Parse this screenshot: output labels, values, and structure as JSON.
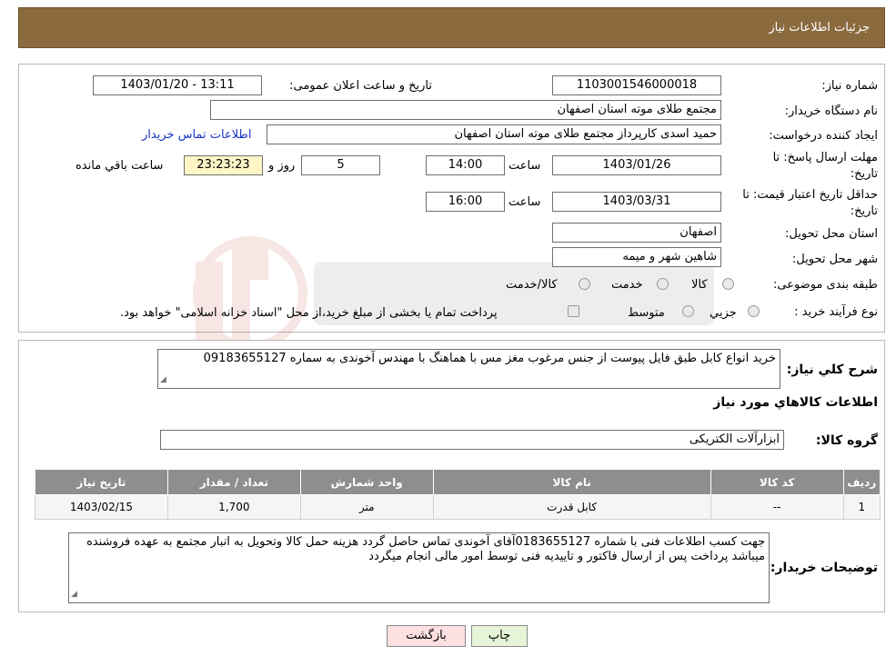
{
  "header": {
    "title": "جزئیات اطلاعات نیاز"
  },
  "form": {
    "need_number_label": "شماره نیاز:",
    "need_number": "1103001546000018",
    "announce_label": "تاریخ و ساعت اعلان عمومی:",
    "announce_value": "1403/01/20 - 13:11",
    "buyer_org_label": "نام دستگاه خریدار:",
    "buyer_org": "مجتمع طلای موته استان اصفهان",
    "creator_label": "ایجاد کننده درخواست:",
    "creator": "حمید اسدی کارپرداز مجتمع طلای موته استان اصفهان",
    "contact_link": "اطلاعات تماس خریدار",
    "deadline_label_1": "مهلت ارسال پاسخ: تا",
    "deadline_label_2": "تاریخ:",
    "deadline_date": "1403/01/26",
    "time_label": "ساعت",
    "deadline_time": "14:00",
    "days_value": "5",
    "days_label": "روز و",
    "remaining_time": "23:23:23",
    "remaining_label": "ساعت باقي مانده",
    "price_validity_label_1": "حداقل تاریخ اعتبار قیمت: تا",
    "price_validity_label_2": "تاریخ:",
    "price_validity_date": "1403/03/31",
    "price_validity_time": "16:00",
    "province_label": "استان محل تحویل:",
    "province": "اصفهان",
    "city_label": "شهر محل تحویل:",
    "city": "شاهین شهر و میمه",
    "category_label": "طبقه بندی موضوعی:",
    "category_options": [
      "کالا",
      "خدمت",
      "کالا/خدمت"
    ],
    "purchase_type_label": "نوع فرآیند خرید :",
    "purchase_options": [
      "جزيي",
      "متوسط"
    ],
    "purchase_note": "پرداخت تمام یا بخشی از مبلغ خرید،از محل \"اسناد خزانه اسلامی\" خواهد بود."
  },
  "details": {
    "summary_label": "شرح کلي نياز:",
    "summary_text": "خرید انواع کابل طبق فایل پیوست از جنس مرغوب مغز مس با هماهنگ با مهندس آخوندی به سماره 09183655127",
    "goods_info_title": "اطلاعات کالاهاي مورد نياز",
    "goods_group_label": "گروه کالا:",
    "goods_group": "ابزارآلات الکتریکی",
    "table": {
      "headers": [
        "رديف",
        "کد کالا",
        "نام کالا",
        "واحد شمارش",
        "تعداد / مقدار",
        "تاريخ نياز"
      ],
      "rows": [
        [
          "1",
          "--",
          "کابل قدرت",
          "متر",
          "1,700",
          "1403/02/15"
        ]
      ]
    },
    "buyer_notes_label": "توضیحات خریدار:",
    "buyer_notes": "جهت کسب اطلاعات فنی با شماره 0183655127آقای آخوندی تماس حاصل گردد هزینه حمل کالا وتحویل به انبار مجتمع به عهده فروشنده میباشد پرداخت پس از ارسال فاکتور و تاییدیه فنی توسط امور مالی انجام میگردد"
  },
  "buttons": {
    "print": "چاپ",
    "back": "بازگشت"
  },
  "colors": {
    "header": "#8b6a3e",
    "back_button": "#fde0e0",
    "print_button": "#e6f5d8",
    "remaining_box": "#fff6c7"
  }
}
